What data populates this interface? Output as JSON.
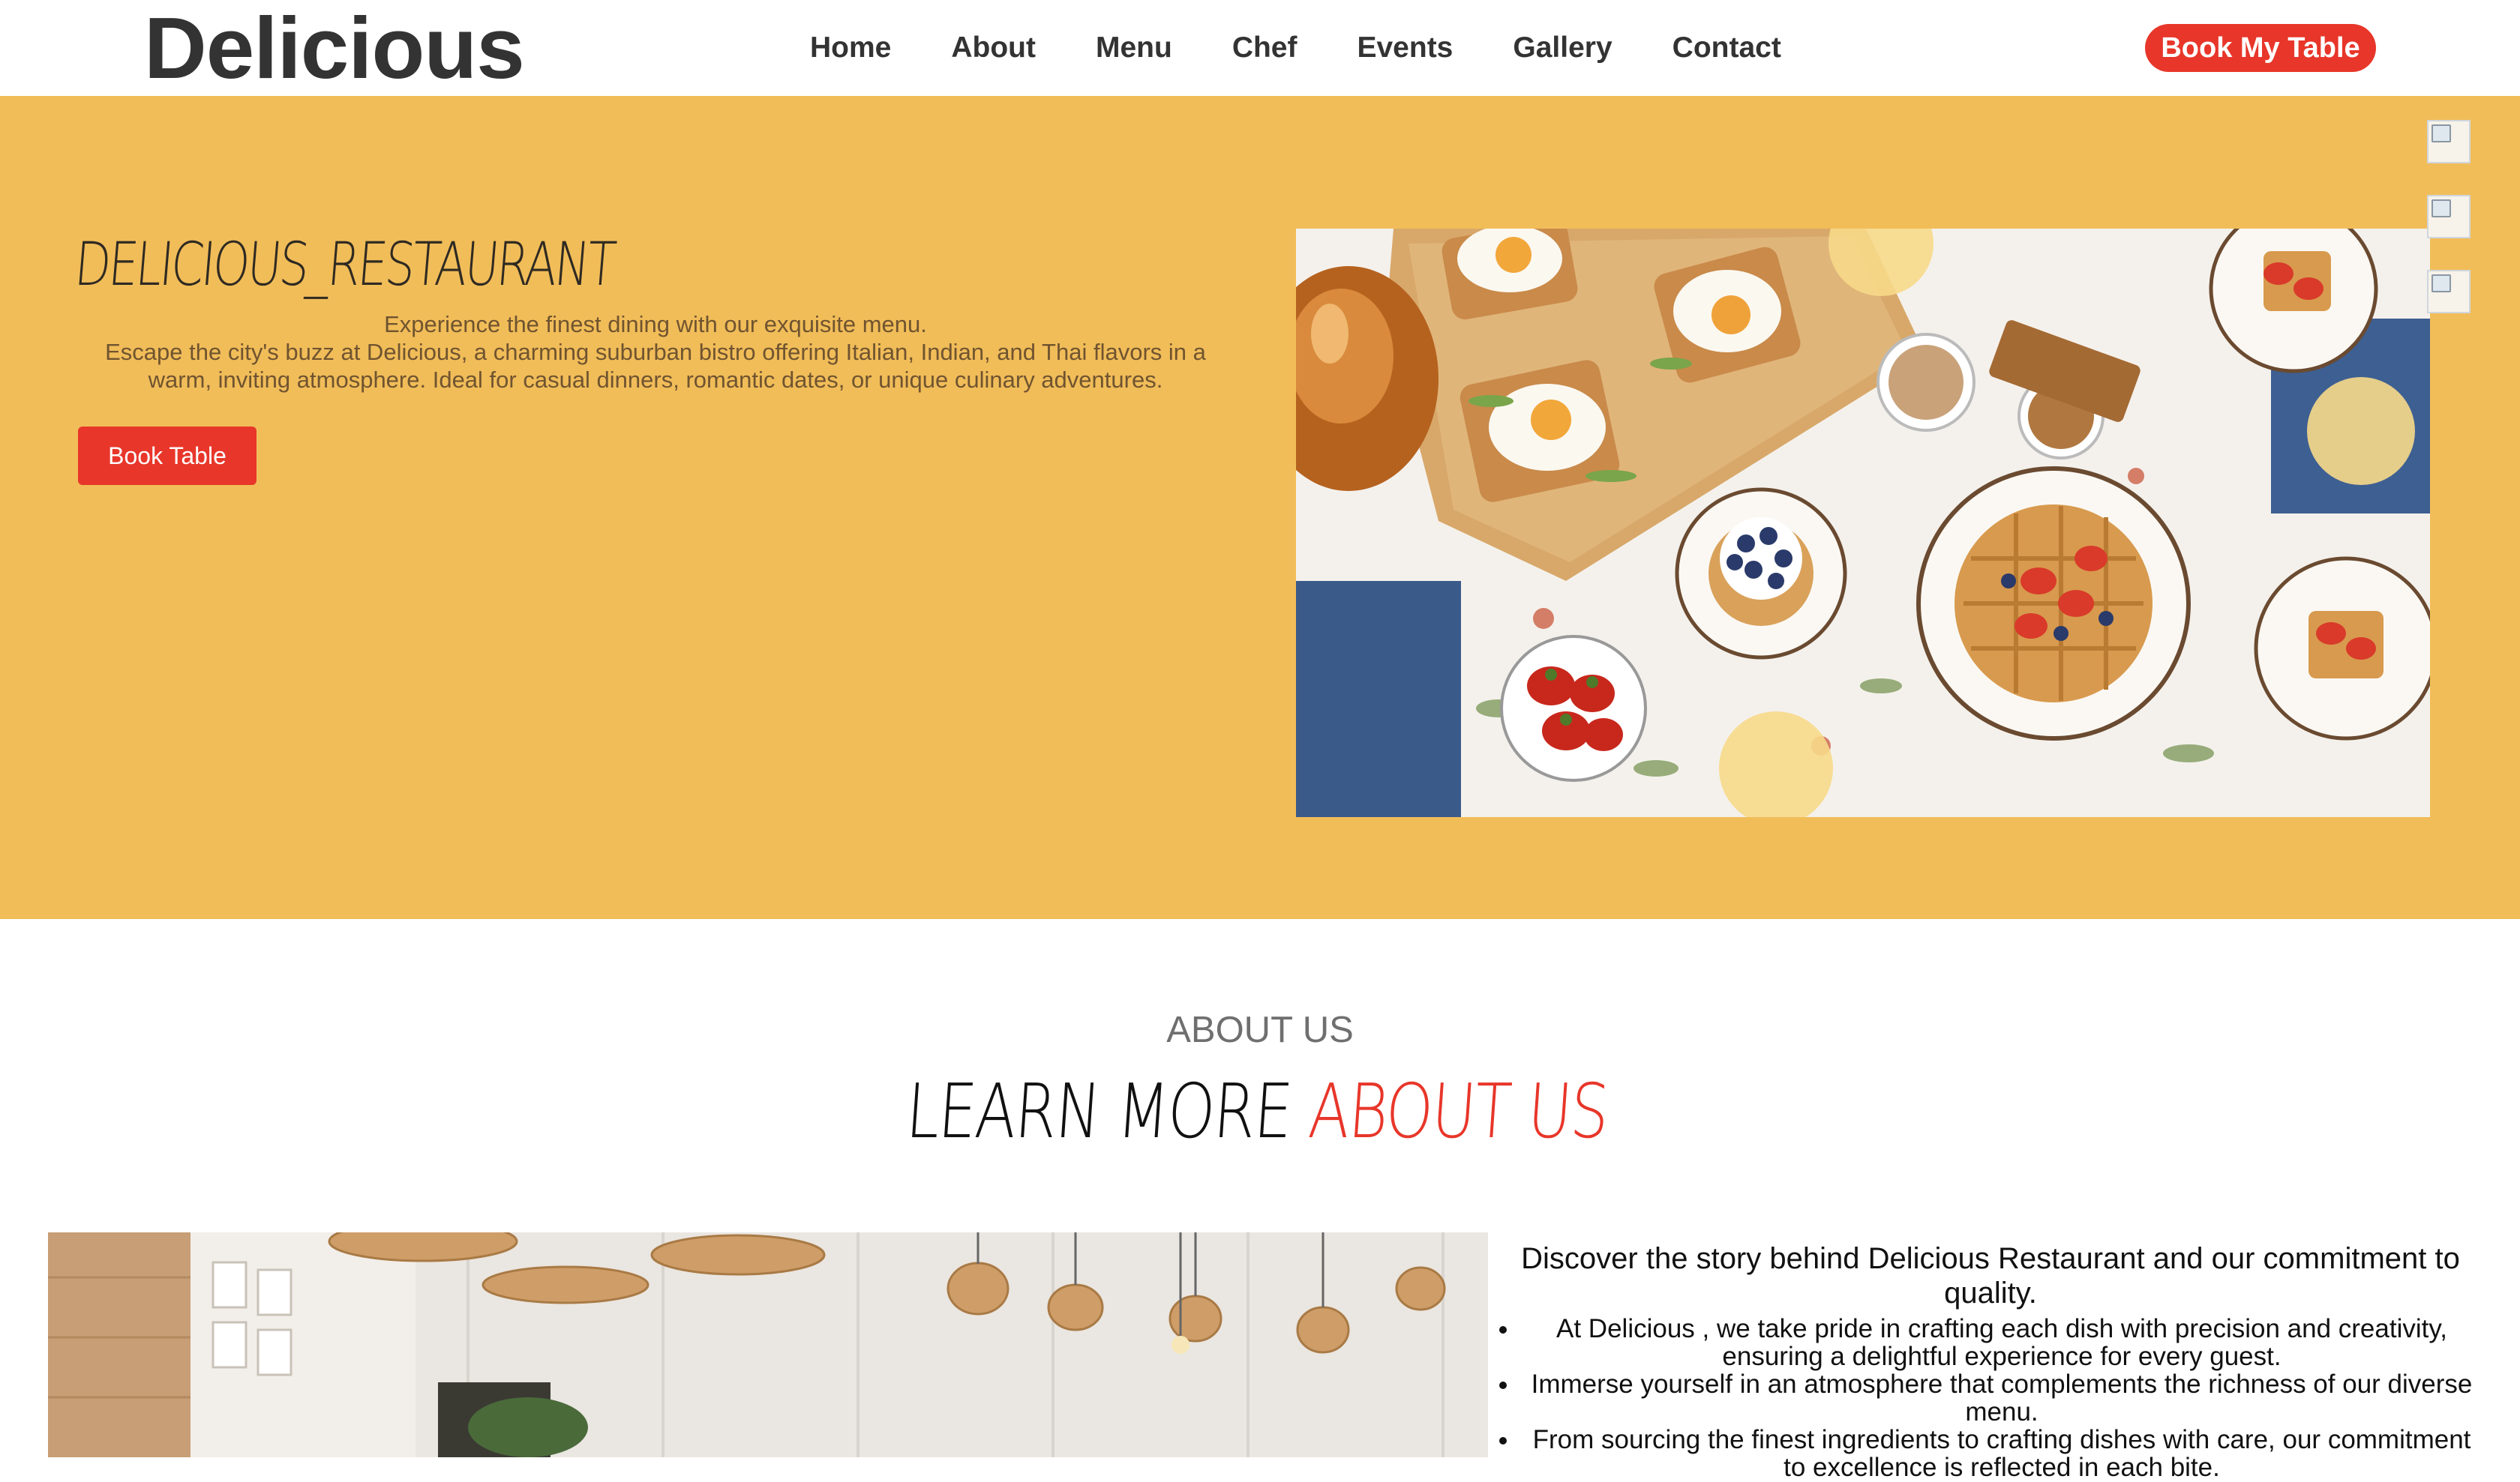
{
  "header": {
    "logo": "Delicious",
    "nav": [
      "Home",
      "About",
      "Menu",
      "Chef",
      "Events",
      "Gallery",
      "Contact"
    ],
    "cta_label": "Book My Table",
    "cta_color": "#e8362a"
  },
  "hero": {
    "title": "DELICIOUS_RESTAURANT",
    "tagline": "Experience the finest dining with our exquisite menu.",
    "description": "Escape the city's buzz at Delicious, a charming suburban bistro offering Italian, Indian, and Thai flavors in a warm, inviting atmosphere. Ideal for casual dinners, romantic dates, or unique culinary adventures.",
    "button_label": "Book Table",
    "background_color": "#f1bd59",
    "image_subject": "breakfast table with waffles, eggs, berries and juice",
    "side_icons": [
      "broken-image-icon",
      "broken-image-icon",
      "broken-image-icon"
    ]
  },
  "about": {
    "label": "ABOUT US",
    "heading_part1": "LEARN MORE",
    "heading_part2": "ABOUT US",
    "image_subject": "restaurant interior with wicker pendant lamps",
    "intro": "Discover the story behind Delicious Restaurant and our commitment to quality.",
    "points": [
      "At Delicious , we take pride in crafting each dish with precision and creativity, ensuring a delightful experience for every guest.",
      "Immerse yourself in an atmosphere that complements the richness of our diverse menu.",
      "From sourcing the finest ingredients to crafting dishes with care, our commitment to excellence is reflected in each bite."
    ]
  }
}
